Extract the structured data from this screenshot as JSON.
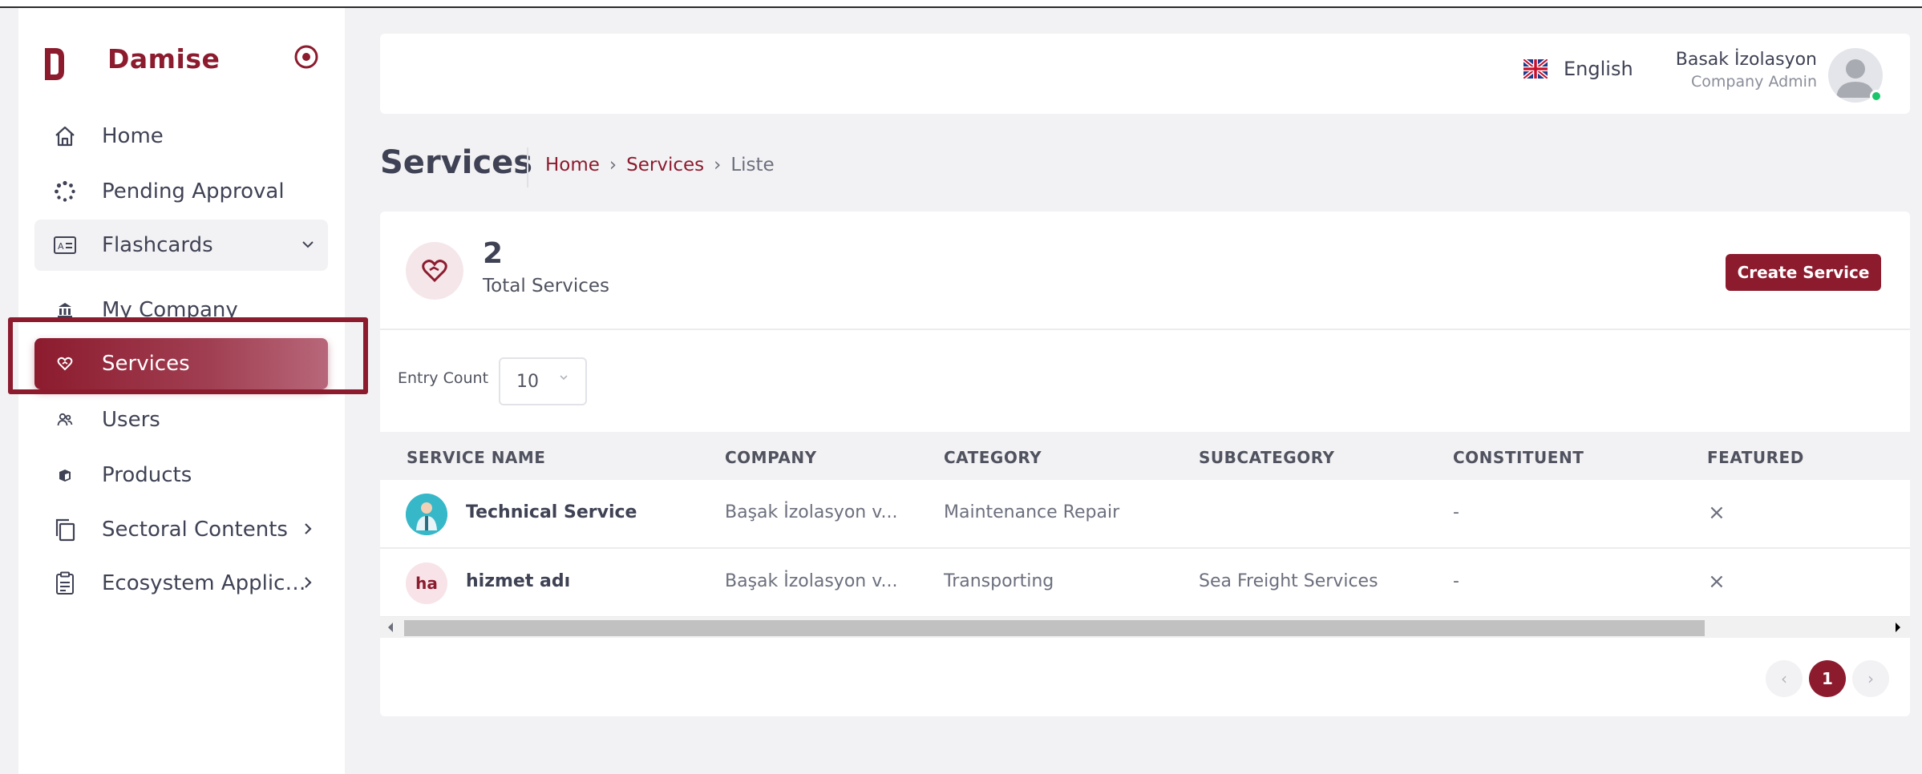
{
  "brand": {
    "name": "Damise"
  },
  "sidebar": {
    "items": [
      {
        "label": "Home",
        "icon": "home-icon"
      },
      {
        "label": "Pending Approval",
        "icon": "loader-icon"
      },
      {
        "label": "Flashcards",
        "icon": "card-icon",
        "expandable": true,
        "state": "expanded"
      },
      {
        "label": "My Company",
        "icon": "building-icon"
      },
      {
        "label": "Services",
        "icon": "heart-hand-icon",
        "active": true
      },
      {
        "label": "Users",
        "icon": "users-icon"
      },
      {
        "label": "Products",
        "icon": "box-icon"
      },
      {
        "label": "Sectoral Contents",
        "icon": "copy-icon",
        "expandable": true
      },
      {
        "label": "Ecosystem Applicat...",
        "icon": "clipboard-icon",
        "expandable": true
      }
    ]
  },
  "header": {
    "language": "English",
    "user_name": "Basak İzolasyon",
    "user_role": "Company Admin",
    "status_color": "#1bc56a"
  },
  "page": {
    "title": "Services",
    "breadcrumb": {
      "home": "Home",
      "services": "Services",
      "current": "Liste",
      "separator": "›"
    }
  },
  "stats": {
    "count": "2",
    "label": "Total Services"
  },
  "actions": {
    "create_label": "Create Service"
  },
  "entry": {
    "label": "Entry Count",
    "value": "10"
  },
  "table": {
    "headers": {
      "service_name": "SERVICE NAME",
      "company": "COMPANY",
      "category": "CATEGORY",
      "subcategory": "SUBCATEGORY",
      "constituent": "CONSTITUENT",
      "featured": "FEATURED"
    },
    "rows": [
      {
        "avatar_initials": "",
        "name": "Technical Service",
        "company": "Başak İzolasyon v...",
        "category": "Maintenance Repair",
        "subcategory": "",
        "constituent": "-",
        "featured": "×"
      },
      {
        "avatar_initials": "ha",
        "name": "hizmet adı",
        "company": "Başak İzolasyon v...",
        "category": "Transporting",
        "subcategory": "Sea Freight Services",
        "constituent": "-",
        "featured": "×"
      }
    ]
  },
  "pagination": {
    "prev": "‹",
    "current": "1",
    "next": "›"
  },
  "colors": {
    "accent": "#8c1b2e",
    "background": "#f2f2f4"
  }
}
